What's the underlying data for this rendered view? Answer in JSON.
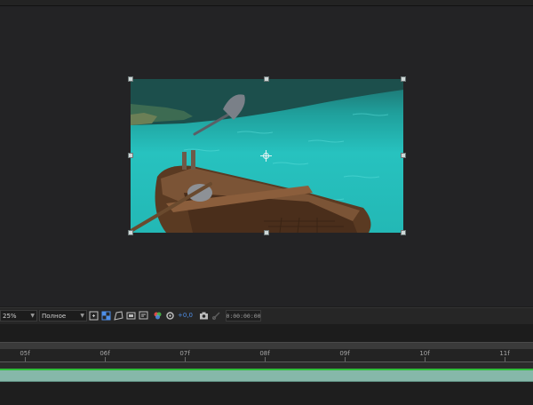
{
  "viewer": {
    "image_description_name": "rowboat-water-frame"
  },
  "toolbar": {
    "zoom": "25%",
    "resolution": "Полное",
    "exposure": "+0,0",
    "timecode": "0:00:00:00",
    "icons": [
      "region-of-interest-icon",
      "transparency-grid-icon",
      "mask-path-icon",
      "guides-icon",
      "safe-margins-icon",
      "color-channels-icon",
      "exposure-reset-icon",
      "snapshot-icon",
      "show-snapshot-icon"
    ],
    "accent_color": "#4f8fe8"
  },
  "timeline": {
    "ticks": [
      "05f",
      "06f",
      "07f",
      "08f",
      "09f",
      "10f",
      "11f"
    ],
    "work_area_color": "#2fbf3a",
    "layer_color": "#86b8a9"
  }
}
